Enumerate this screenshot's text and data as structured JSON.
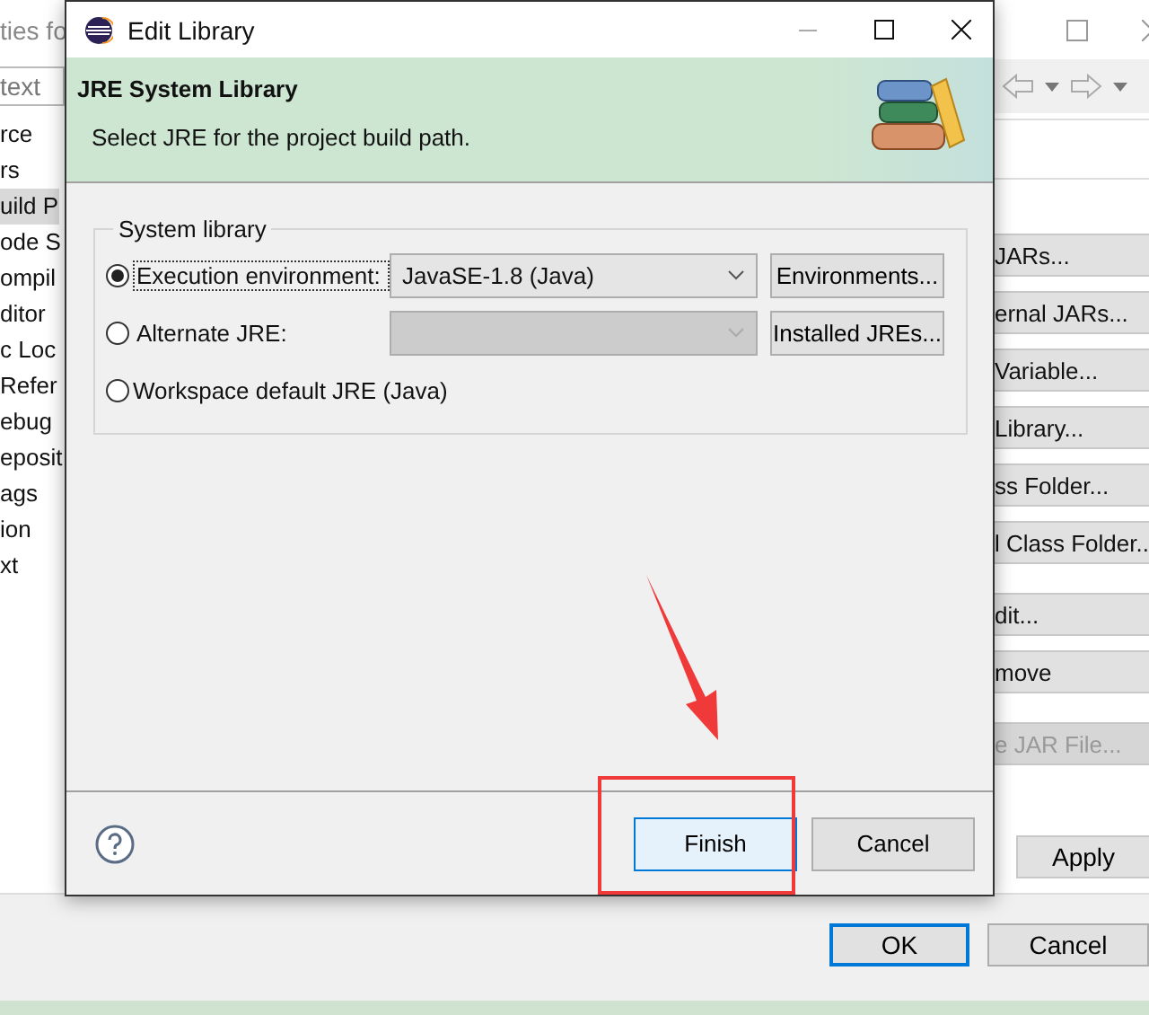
{
  "background_window": {
    "title": "ties fo",
    "filter": {
      "placeholder": "text"
    },
    "sidebar": {
      "items": [
        {
          "label": "rce",
          "selected": false
        },
        {
          "label": "rs",
          "selected": false
        },
        {
          "label": "uild P",
          "selected": true
        },
        {
          "label": "ode S",
          "selected": false
        },
        {
          "label": "ompil",
          "selected": false
        },
        {
          "label": "ditor",
          "selected": false
        },
        {
          "label": "c Loc",
          "selected": false
        },
        {
          "label": "Refer",
          "selected": false
        },
        {
          "label": "ebug",
          "selected": false
        },
        {
          "label": "eposit",
          "selected": false
        },
        {
          "label": "ags",
          "selected": false
        },
        {
          "label": "ion",
          "selected": false
        },
        {
          "label": "xt",
          "selected": false
        }
      ]
    },
    "side_buttons": [
      {
        "label": "JARs...",
        "disabled": false,
        "gap": false
      },
      {
        "label": "ernal JARs...",
        "disabled": false,
        "gap": false
      },
      {
        "label": "Variable...",
        "disabled": false,
        "gap": false
      },
      {
        "label": "Library...",
        "disabled": false,
        "gap": false
      },
      {
        "label": "ss Folder...",
        "disabled": false,
        "gap": false
      },
      {
        "label": "l Class Folder...",
        "disabled": false,
        "gap": false
      },
      {
        "label": "dit...",
        "disabled": false,
        "gap": true
      },
      {
        "label": "move",
        "disabled": false,
        "gap": false
      },
      {
        "label": "e JAR File...",
        "disabled": true,
        "gap": true
      }
    ],
    "apply_button": "Apply",
    "bottom_buttons": [
      {
        "label": "OK",
        "default": true
      },
      {
        "label": "Cancel",
        "default": false
      }
    ]
  },
  "dialog": {
    "title": "Edit Library",
    "header": {
      "title": "JRE System Library",
      "description": "Select JRE for the project build path."
    },
    "group": {
      "title": "System library",
      "options": [
        {
          "label": "Execution environment:",
          "selected": true,
          "combo": {
            "value": "JavaSE-1.8 (Java)",
            "disabled": false
          },
          "button": "Environments..."
        },
        {
          "label": "Alternate JRE:",
          "selected": false,
          "combo": {
            "disabled": true
          },
          "button": "Installed JREs..."
        },
        {
          "label": "Workspace default JRE (Java)",
          "selected": false
        }
      ]
    },
    "buttons": [
      {
        "label": "Finish",
        "default": true
      },
      {
        "label": "Cancel",
        "default": false
      }
    ]
  }
}
